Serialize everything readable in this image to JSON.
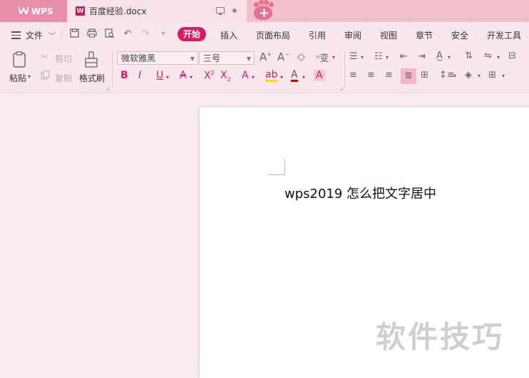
{
  "tabs": {
    "app_label": "WPS",
    "doc_name": "百度经验.docx"
  },
  "menu": {
    "file_label": "文件",
    "tabs": [
      "开始",
      "插入",
      "页面布局",
      "引用",
      "审阅",
      "视图",
      "章节",
      "安全",
      "开发工具"
    ],
    "active_tab": "开始"
  },
  "ribbon": {
    "paste": "粘贴",
    "cut": "剪切",
    "copy": "复制",
    "format_painter": "格式刷",
    "font_name": "微软雅黑",
    "font_size": "三号"
  },
  "document": {
    "text": "wps2019 怎么把文字居中"
  },
  "watermark": "软件技巧",
  "colors": {
    "accent": "#d81b60",
    "tabbar": "#f2bfcc",
    "ribbon": "#f8e8ec"
  }
}
